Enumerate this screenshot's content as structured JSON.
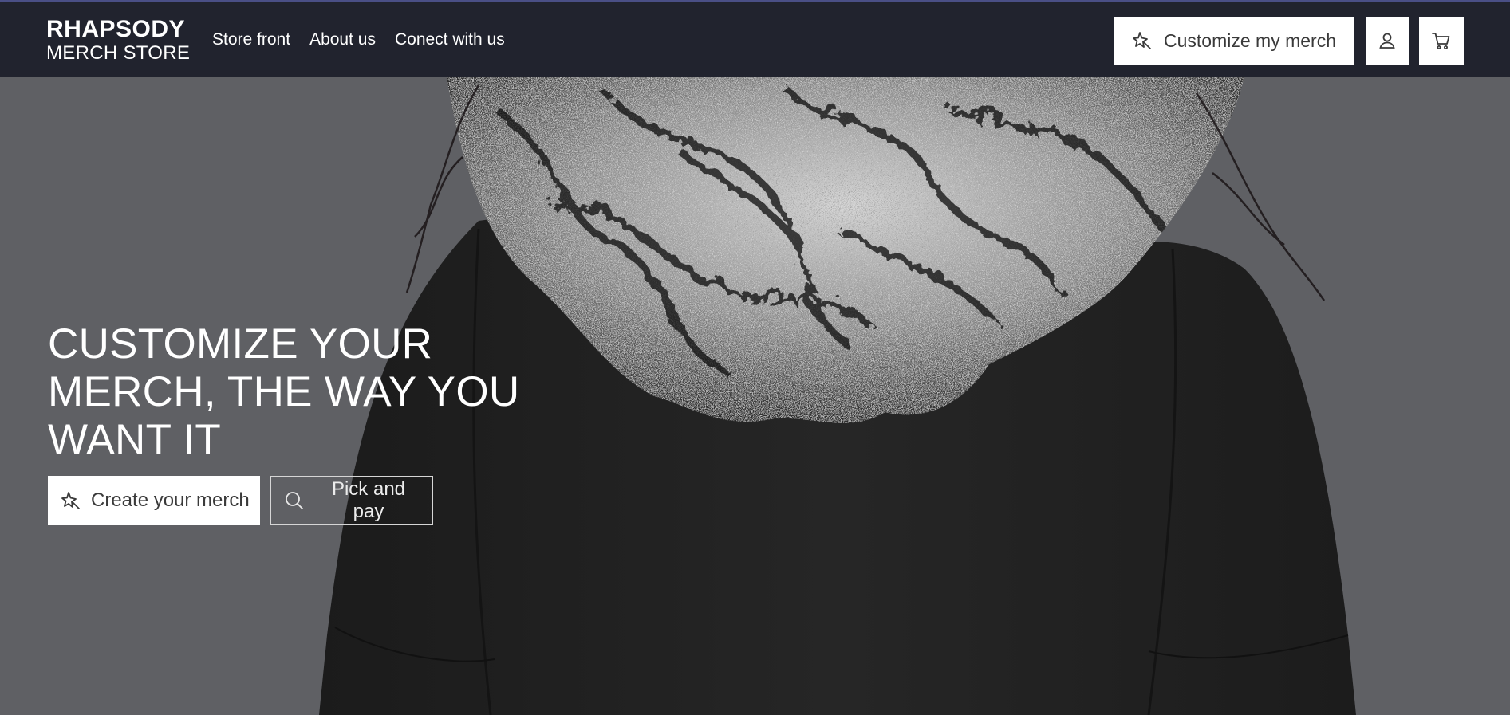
{
  "brand": {
    "line1": "RHAPSODY",
    "line2": "MERCH STORE"
  },
  "nav": {
    "items": [
      {
        "label": "Store front"
      },
      {
        "label": "About us"
      },
      {
        "label": "Conect with us"
      }
    ]
  },
  "header_actions": {
    "customize_label": "Customize my merch",
    "customize_icon": "sparkle-icon",
    "account_icon": "user-icon",
    "cart_icon": "cart-icon"
  },
  "hero": {
    "headline": "CUSTOMIZE YOUR MERCH, THE WAY YOU WANT IT",
    "primary_cta": "Create your merch",
    "primary_cta_icon": "sparkle-icon",
    "secondary_cta": "Pick and pay",
    "secondary_cta_icon": "search-icon"
  },
  "colors": {
    "header_bg": "#21232e",
    "hero_bg": "#5e5f63",
    "button_bg": "#ffffff",
    "text_light": "#ffffff"
  }
}
